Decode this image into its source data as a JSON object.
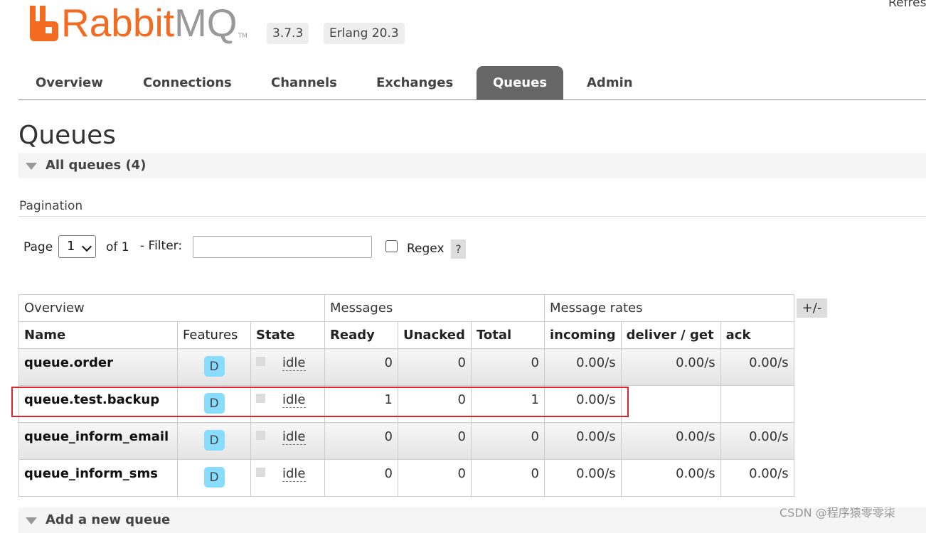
{
  "header": {
    "logo_brand": "Rabbit",
    "logo_mq": "MQ",
    "logo_tm": "TM",
    "version": "3.7.3",
    "erlang": "Erlang 20.3",
    "refresh": "Refres"
  },
  "tabs": [
    {
      "label": "Overview",
      "active": false
    },
    {
      "label": "Connections",
      "active": false
    },
    {
      "label": "Channels",
      "active": false
    },
    {
      "label": "Exchanges",
      "active": false
    },
    {
      "label": "Queues",
      "active": true
    },
    {
      "label": "Admin",
      "active": false
    }
  ],
  "page": {
    "title": "Queues",
    "all_queues_label": "All queues (4)",
    "pagination_label": "Pagination",
    "add_queue_label": "Add a new queue"
  },
  "pagination": {
    "page_label": "Page",
    "page_value": "1",
    "of_label": "of 1",
    "filter_label": "- Filter:",
    "filter_value": "",
    "regex_label": "Regex",
    "regex_checked": false,
    "help": "?"
  },
  "table": {
    "groups": [
      "Overview",
      "Messages",
      "Message rates"
    ],
    "columns": [
      "Name",
      "Features",
      "State",
      "Ready",
      "Unacked",
      "Total",
      "incoming",
      "deliver / get",
      "ack"
    ],
    "plus_minus": "+/-",
    "rows": [
      {
        "name": "queue.order",
        "feature": "D",
        "state": "idle",
        "ready": "0",
        "unacked": "0",
        "total": "0",
        "incoming": "0.00/s",
        "deliver_get": "0.00/s",
        "ack": "0.00/s"
      },
      {
        "name": "queue.test.backup",
        "feature": "D",
        "state": "idle",
        "ready": "1",
        "unacked": "0",
        "total": "1",
        "incoming": "0.00/s",
        "deliver_get": "",
        "ack": ""
      },
      {
        "name": "queue_inform_email",
        "feature": "D",
        "state": "idle",
        "ready": "0",
        "unacked": "0",
        "total": "0",
        "incoming": "0.00/s",
        "deliver_get": "0.00/s",
        "ack": "0.00/s"
      },
      {
        "name": "queue_inform_sms",
        "feature": "D",
        "state": "idle",
        "ready": "0",
        "unacked": "0",
        "total": "0",
        "incoming": "0.00/s",
        "deliver_get": "0.00/s",
        "ack": "0.00/s"
      }
    ]
  },
  "watermark": "CSDN @程序猿零零柒",
  "colors": {
    "brand_orange": "#f26b21",
    "tab_active": "#666666",
    "feature_badge": "#88ddff",
    "highlight_box": "#d9232e"
  }
}
